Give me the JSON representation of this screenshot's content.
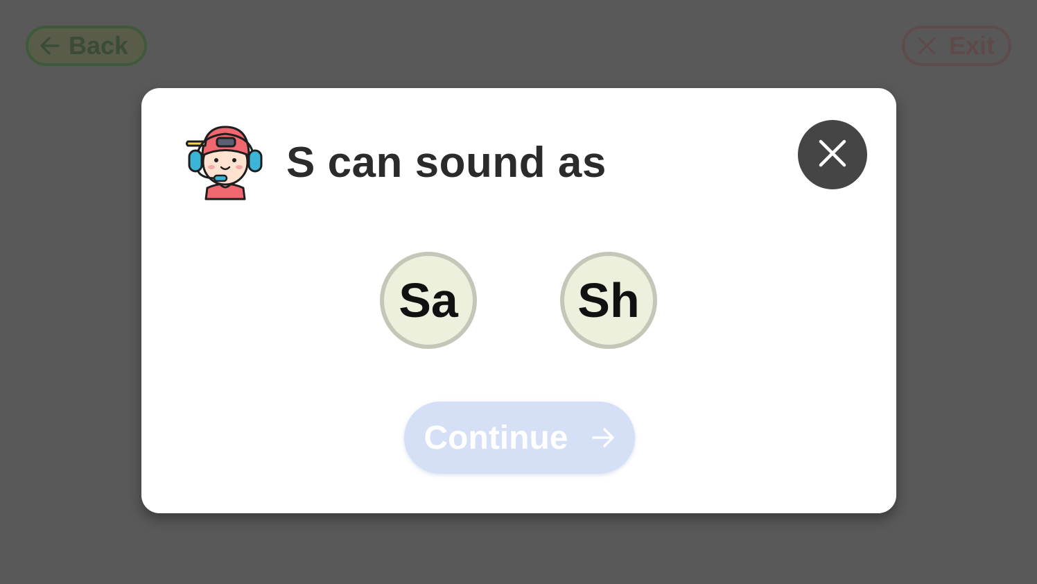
{
  "background": {
    "back_button": {
      "label": "Back",
      "icon": "arrow-left-icon"
    },
    "exit_button": {
      "label": "Exit",
      "icon": "close-icon"
    }
  },
  "dialog": {
    "title": "S can sound as",
    "avatar_icon": "kid-with-headset-icon",
    "close_icon": "close-icon",
    "sound_options": [
      "Sa",
      "Sh"
    ],
    "continue_button": {
      "label": "Continue",
      "icon": "arrow-right-icon",
      "state": "disabled"
    }
  },
  "colors": {
    "overlay": "#595959",
    "dialog": "#ffffff",
    "close_button": "#454545",
    "option_fill": "#edf0dc",
    "option_border": "#c4c6b8",
    "continue_disabled": "#d5e0f6"
  }
}
